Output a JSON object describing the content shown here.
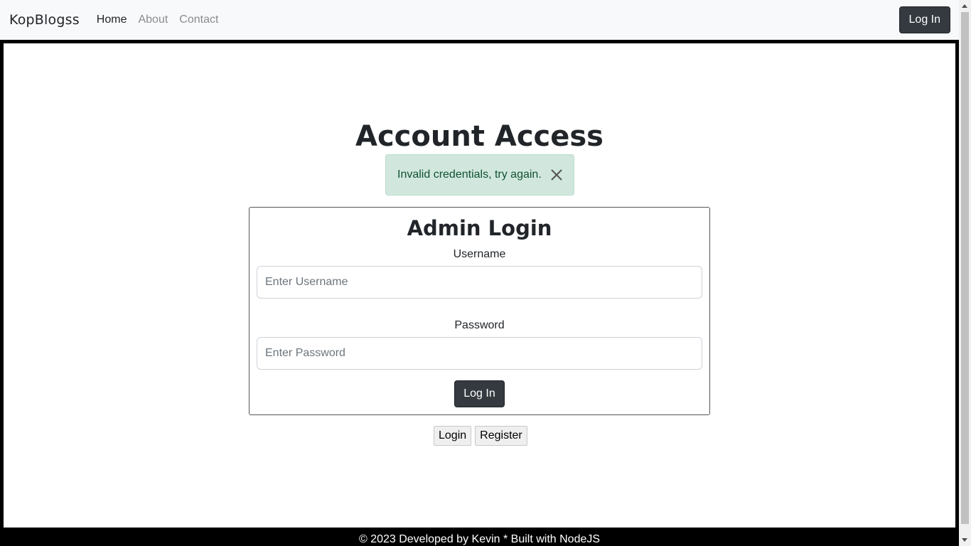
{
  "navbar": {
    "brand": "KopBlogss",
    "links": [
      {
        "label": "Home",
        "active": true
      },
      {
        "label": "About",
        "active": false
      },
      {
        "label": "Contact",
        "active": false
      }
    ],
    "login_button": "Log In"
  },
  "main": {
    "title": "Account Access",
    "alert": {
      "message": "Invalid credentials, try again.",
      "close_icon": "close-icon"
    },
    "login_form": {
      "title": "Admin Login",
      "username_label": "Username",
      "username_placeholder": "Enter Username",
      "username_value": "",
      "password_label": "Password",
      "password_placeholder": "Enter Password",
      "password_value": "",
      "submit_label": "Log In"
    },
    "switch_buttons": {
      "login": "Login",
      "register": "Register"
    }
  },
  "footer": {
    "text": "© 2023 Developed by Kevin * Built with NodeJS"
  },
  "colors": {
    "navbar_bg": "#f8f9fa",
    "dark_button": "#343a40",
    "alert_bg": "#d1e7dd",
    "alert_text": "#0f5132",
    "footer_bg": "#000000"
  }
}
